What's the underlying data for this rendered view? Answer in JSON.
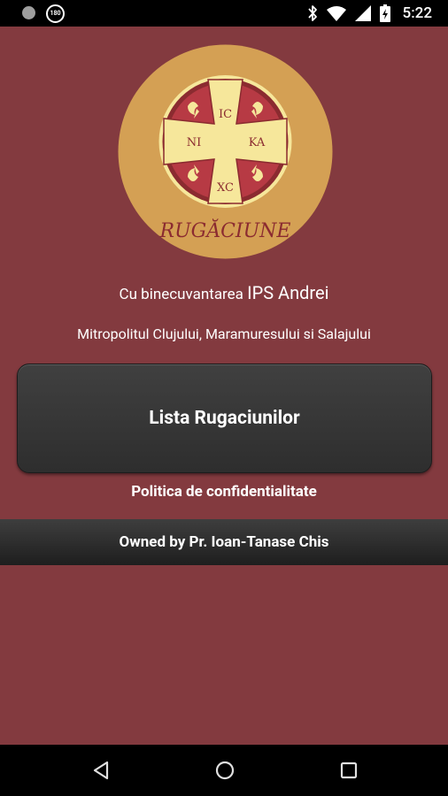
{
  "status_bar": {
    "notification_badge": "180",
    "time": "5:22",
    "icons": [
      "circle-notification-icon",
      "badge-notification-icon",
      "bluetooth-icon",
      "wifi-icon",
      "signal-icon",
      "battery-icon"
    ]
  },
  "logo": {
    "top_left": "IC",
    "top_right": "",
    "middle_left": "NI",
    "middle_right": "KA",
    "bottom": "XC",
    "wordmark": "RUGĂCIUNE",
    "colors": {
      "ring": "#d4a054",
      "cross": "#f6e79b",
      "background": "#b73a44"
    }
  },
  "blessing": {
    "prefix": "Cu binecuvantarea",
    "name": "IPS Andrei",
    "title": "Mitropolitul Clujului, Maramuresului si Salajului"
  },
  "main_button": {
    "label": "Lista Rugaciunilor"
  },
  "privacy_link": {
    "label": "Politica de confidentialitate"
  },
  "owner": {
    "label": "Owned by Pr. Ioan-Tanase Chis"
  },
  "nav_bar": {
    "icons": [
      "back-icon",
      "home-icon",
      "recents-icon"
    ]
  },
  "colors": {
    "background": "#833a3f",
    "button": "#363636",
    "text": "#ffffff"
  }
}
